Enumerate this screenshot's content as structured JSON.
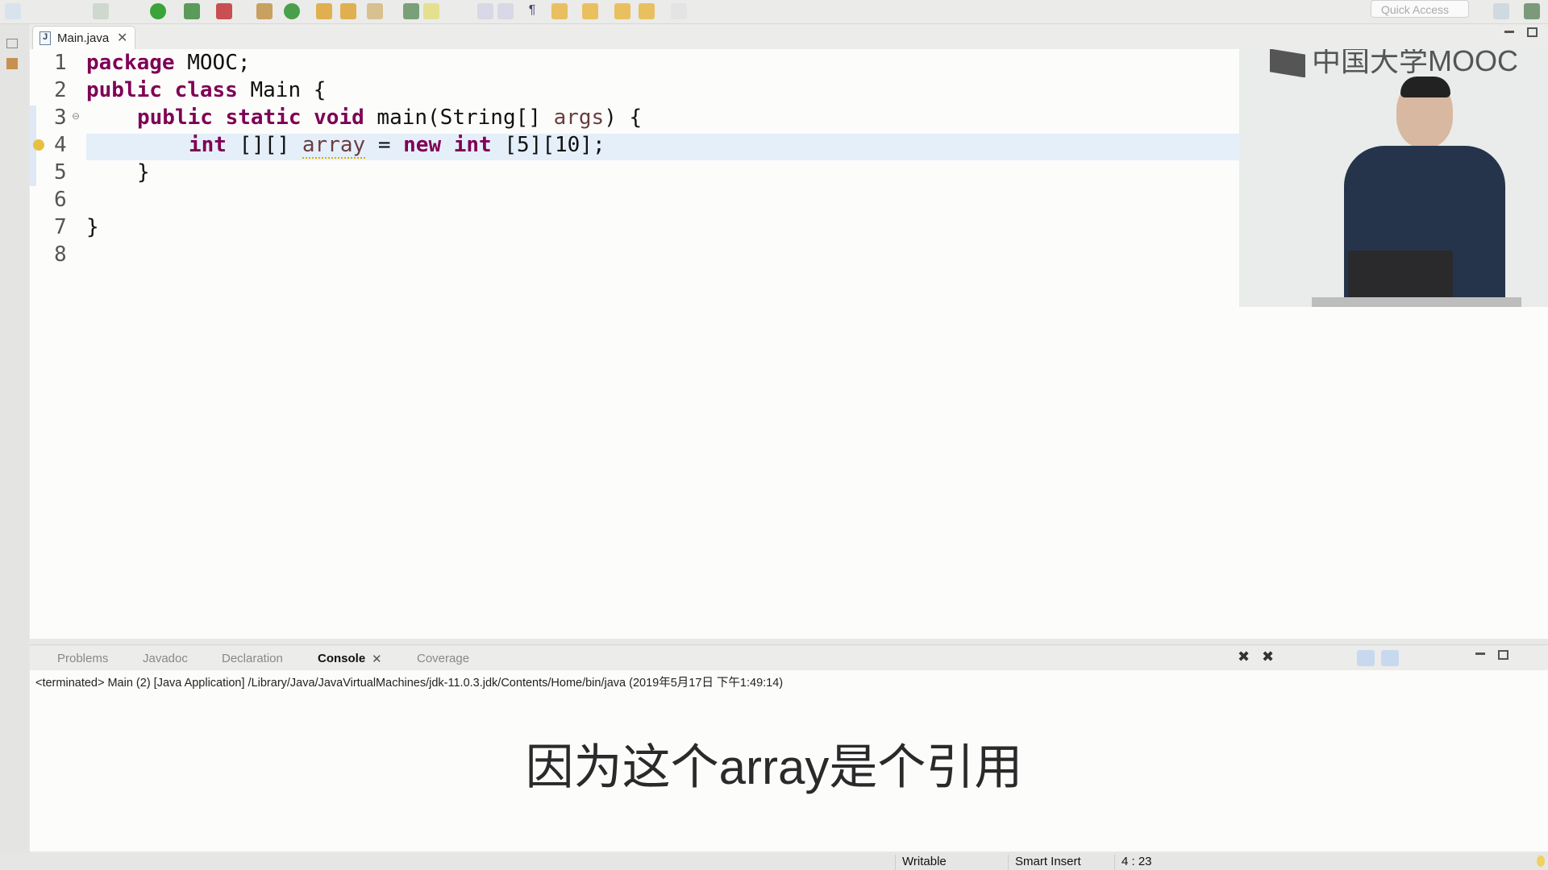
{
  "toolbar": {
    "quick_access_placeholder": "Quick Access"
  },
  "editor": {
    "tab_label": "Main.java",
    "lines": [
      {
        "n": "1",
        "parts": [
          [
            "kw",
            "package"
          ],
          [
            "",
            "  MOOC;"
          ]
        ]
      },
      {
        "n": "2",
        "parts": [
          [
            "kw",
            "public class"
          ],
          [
            "",
            "  Main {"
          ]
        ]
      }
    ],
    "line_numbers": [
      "1",
      "2",
      "3",
      "4",
      "5",
      "6",
      "7",
      "8"
    ],
    "code": {
      "l1_kw": "package",
      "l1_rest": " MOOC;",
      "l2_kw": "public class",
      "l2_rest": " Main {",
      "l3_kw": "public static void",
      "l3_rest1": " main(String[] ",
      "l3_var": "args",
      "l3_rest2": ") {",
      "l4_kw1": "int",
      "l4_rest1": " [][] ",
      "l4_var": "array",
      "l4_rest2": " = ",
      "l4_kw2": "new int",
      "l4_rest3": " [5][10];",
      "l5": "}",
      "l7": "}"
    }
  },
  "video": {
    "logo_text": "中国大学MOOC"
  },
  "console": {
    "tabs": [
      {
        "label": "Problems"
      },
      {
        "label": "Javadoc"
      },
      {
        "label": "Declaration"
      },
      {
        "label": "Console",
        "active": true
      },
      {
        "label": "Coverage"
      }
    ],
    "terminated_text": "<terminated> Main (2) [Java Application] /Library/Java/JavaVirtualMachines/jdk-11.0.3.jdk/Contents/Home/bin/java (2019年5月17日 下午1:49:14)"
  },
  "subtitle": "因为这个array是个引用",
  "status": {
    "writable": "Writable",
    "insert_mode": "Smart Insert",
    "position": "4 : 23"
  },
  "colors": {
    "keyword": "#7f0055",
    "variable": "#6a3e3e",
    "current_line": "#e5effa"
  }
}
